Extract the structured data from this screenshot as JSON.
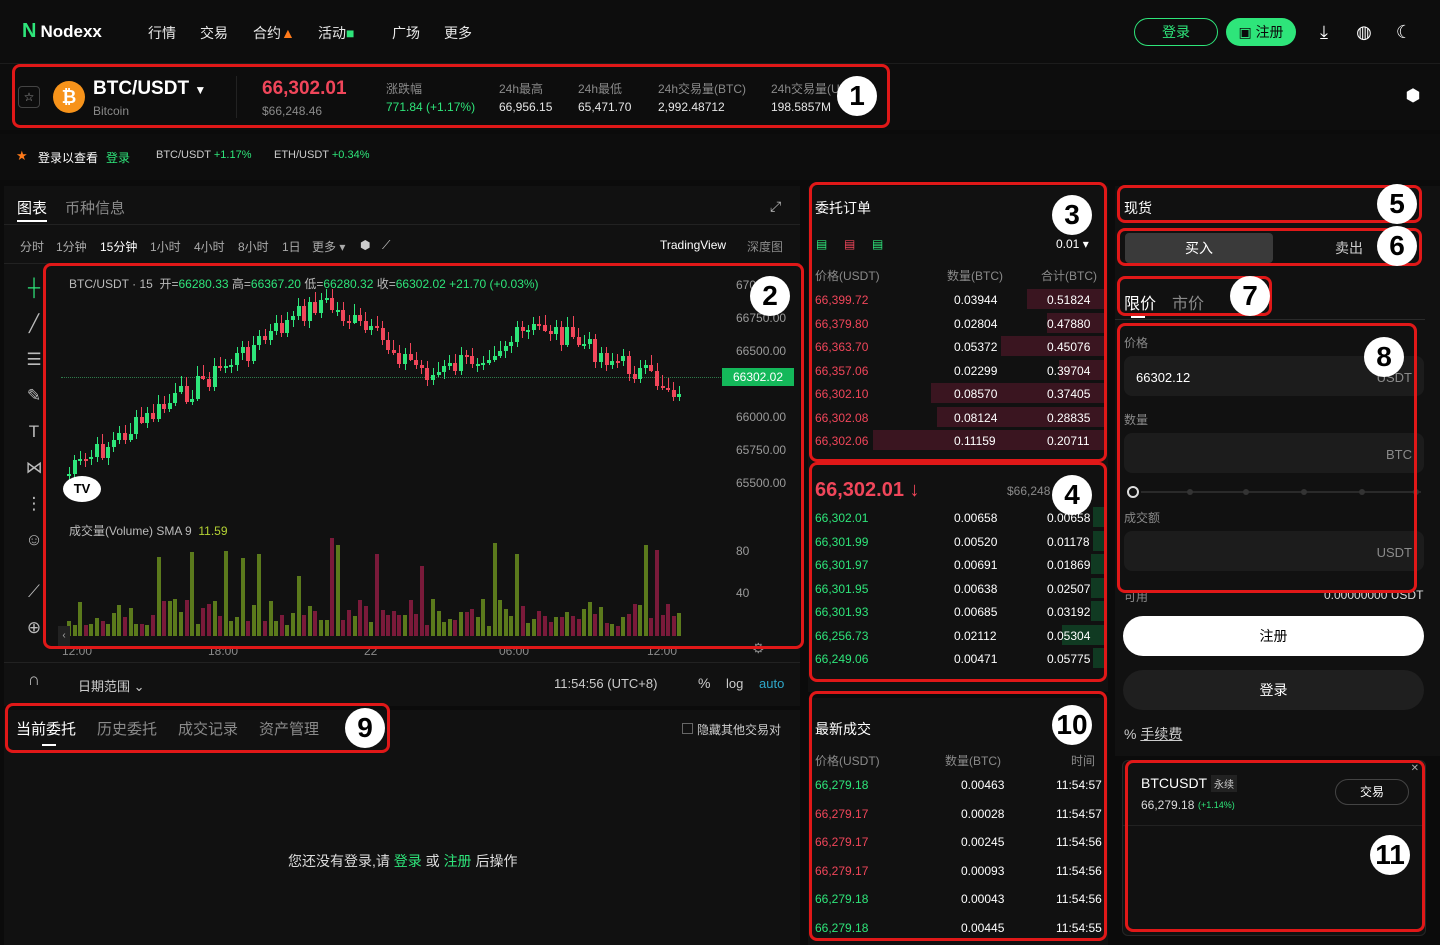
{
  "nav": {
    "logo": "Nodexx",
    "items": [
      "行情",
      "交易",
      "合约",
      "活动",
      "广场",
      "更多"
    ],
    "login": "登录",
    "register": "注册"
  },
  "ticker": {
    "pair": "BTC/USDT",
    "coin_name": "Bitcoin",
    "price": "66,302.01",
    "price_usd": "$66,248.46",
    "change_label": "涨跌幅",
    "change_value": "771.84 (+1.17%)",
    "high_label": "24h最高",
    "high_value": "66,956.15",
    "low_label": "24h最低",
    "low_value": "65,471.70",
    "vol_btc_label": "24h交易量(BTC)",
    "vol_btc_value": "2,992.48712",
    "vol_usdt_label": "24h交易量(U",
    "vol_usdt_value": "198.5857M"
  },
  "watch": {
    "prompt": "登录以查看",
    "login": "登录",
    "pair1": "BTC/USDT",
    "pair1_change": "+1.17%",
    "pair2": "ETH/USDT",
    "pair2_change": "+0.34%"
  },
  "chart_panel": {
    "tab_chart": "图表",
    "tab_info": "币种信息",
    "intervals": [
      "分时",
      "1分钟",
      "15分钟",
      "1小时",
      "4小时",
      "8小时",
      "1日",
      "更多"
    ],
    "tradingview": "TradingView",
    "depth": "深度图",
    "legend": "BTC/USDT · 15",
    "legend_o_label": "开=",
    "legend_o": "66280.33",
    "legend_h_label": "高=",
    "legend_h": "66367.20",
    "legend_l_label": "低=",
    "legend_l": "66280.32",
    "legend_c_label": "收=",
    "legend_c": "66302.02",
    "legend_change": "+21.70 (+0.03%)",
    "vol_legend": "成交量(Volume) SMA 9",
    "vol_value": "11.59",
    "price_tag": "66302.02",
    "y_labels": [
      "670",
      "66750.00",
      "66500.00",
      "66000.00",
      "65750.00",
      "65500.00"
    ],
    "vol_y_labels": [
      "80",
      "40"
    ],
    "x_labels": [
      "12:00",
      "18:00",
      "22",
      "06:00",
      "12:00"
    ],
    "date_range": "日期范围",
    "clock": "11:54:56 (UTC+8)",
    "pct": "%",
    "log": "log",
    "auto": "auto"
  },
  "orderbook": {
    "title": "委托订单",
    "precision": "0.01",
    "col_price": "价格(USDT)",
    "col_amount": "数量(BTC)",
    "col_total": "合计(BTC)",
    "asks": [
      {
        "price": "66,399.72",
        "amount": "0.03944",
        "total": "0.51824",
        "depth": 0.27
      },
      {
        "price": "66,379.80",
        "amount": "0.02804",
        "total": "0.47880",
        "depth": 0.2
      },
      {
        "price": "66,363.70",
        "amount": "0.05372",
        "total": "0.45076",
        "depth": 0.36
      },
      {
        "price": "66,357.06",
        "amount": "0.02299",
        "total": "0.39704",
        "depth": 0.16
      },
      {
        "price": "66,302.10",
        "amount": "0.08570",
        "total": "0.37405",
        "depth": 0.6
      },
      {
        "price": "66,302.08",
        "amount": "0.08124",
        "total": "0.28835",
        "depth": 0.58
      },
      {
        "price": "66,302.06",
        "amount": "0.11159",
        "total": "0.20711",
        "depth": 0.8
      }
    ],
    "last_price": "66,302.01",
    "last_usd": "$66,248",
    "bids": [
      {
        "price": "66,302.01",
        "amount": "0.00658",
        "total": "0.00658",
        "depth": 0.04
      },
      {
        "price": "66,301.99",
        "amount": "0.00520",
        "total": "0.01178",
        "depth": 0.04
      },
      {
        "price": "66,301.97",
        "amount": "0.00691",
        "total": "0.01869",
        "depth": 0.05
      },
      {
        "price": "66,301.95",
        "amount": "0.00638",
        "total": "0.02507",
        "depth": 0.05
      },
      {
        "price": "66,301.93",
        "amount": "0.00685",
        "total": "0.03192",
        "depth": 0.05
      },
      {
        "price": "66,256.73",
        "amount": "0.02112",
        "total": "0.05304",
        "depth": 0.15
      },
      {
        "price": "66,249.06",
        "amount": "0.00471",
        "total": "0.05775",
        "depth": 0.04
      }
    ]
  },
  "trades": {
    "title": "最新成交",
    "col_price": "价格(USDT)",
    "col_amount": "数量(BTC)",
    "col_time": "时间",
    "rows": [
      {
        "price": "66,279.18",
        "amount": "0.00463",
        "time": "11:54:57",
        "side": "buy"
      },
      {
        "price": "66,279.17",
        "amount": "0.00028",
        "time": "11:54:57",
        "side": "sell"
      },
      {
        "price": "66,279.17",
        "amount": "0.00245",
        "time": "11:54:56",
        "side": "sell"
      },
      {
        "price": "66,279.17",
        "amount": "0.00093",
        "time": "11:54:56",
        "side": "sell"
      },
      {
        "price": "66,279.18",
        "amount": "0.00043",
        "time": "11:54:56",
        "side": "buy"
      },
      {
        "price": "66,279.18",
        "amount": "0.00445",
        "time": "11:54:55",
        "side": "buy"
      }
    ]
  },
  "orders": {
    "tabs": [
      "当前委托",
      "历史委托",
      "成交记录",
      "资产管理"
    ],
    "hide_others": "隐藏其他交易对",
    "empty_prefix": "您还没有登录,请",
    "empty_login": "登录",
    "empty_or": "或",
    "empty_register": "注册",
    "empty_suffix": "后操作"
  },
  "trade_form": {
    "spot": "现货",
    "buy": "买入",
    "sell": "卖出",
    "limit": "限价",
    "market": "市价",
    "price_label": "价格",
    "price_value": "66302.12",
    "price_unit": "USDT",
    "qty_label": "数量",
    "qty_unit": "BTC",
    "total_label": "成交额",
    "total_unit": "USDT",
    "avail_label": "可用",
    "avail_value": "0.00000000 USDT",
    "register_btn": "注册",
    "login_btn": "登录",
    "fee": "手续费"
  },
  "promo": {
    "symbol": "BTCUSDT",
    "tag": "永续",
    "price": "66,279.18",
    "change": "(+1.14%)",
    "trade_btn": "交易"
  },
  "annotations": [
    "1",
    "2",
    "3",
    "4",
    "5",
    "6",
    "7",
    "8",
    "9",
    "10",
    "11"
  ]
}
